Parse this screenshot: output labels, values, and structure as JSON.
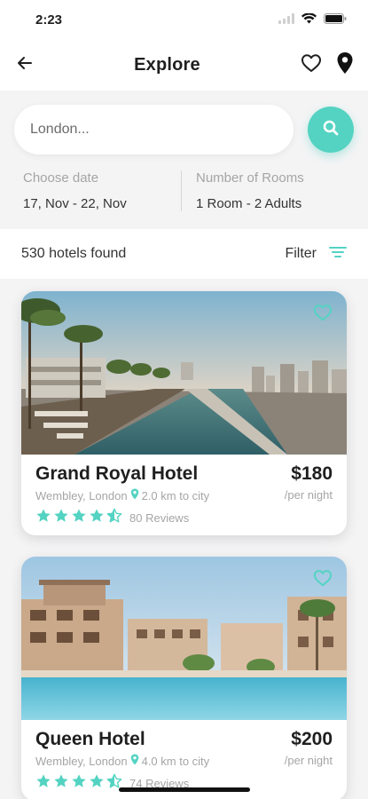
{
  "status_bar": {
    "time": "2:23"
  },
  "header": {
    "title": "Explore"
  },
  "search": {
    "placeholder": "London..."
  },
  "filters": {
    "date_label": "Choose date",
    "date_value": "17, Nov - 22, Nov",
    "rooms_label": "Number of Rooms",
    "rooms_value": "1 Room - 2 Adults"
  },
  "results": {
    "count_text": "530 hotels found",
    "filter_label": "Filter"
  },
  "accent_color": "#54d3c2",
  "hotels": [
    {
      "name": "Grand Royal Hotel",
      "location": "Wembley, London",
      "distance": "2.0 km to city",
      "rating": 4.5,
      "reviews": "80 Reviews",
      "price": "$180",
      "per_night": "/per night",
      "image": "rooftop-infinity-pool"
    },
    {
      "name": "Queen Hotel",
      "location": "Wembley, London",
      "distance": "4.0 km to city",
      "rating": 4.5,
      "reviews": "74 Reviews",
      "price": "$200",
      "per_night": "/per night",
      "image": "resort-pool"
    }
  ]
}
